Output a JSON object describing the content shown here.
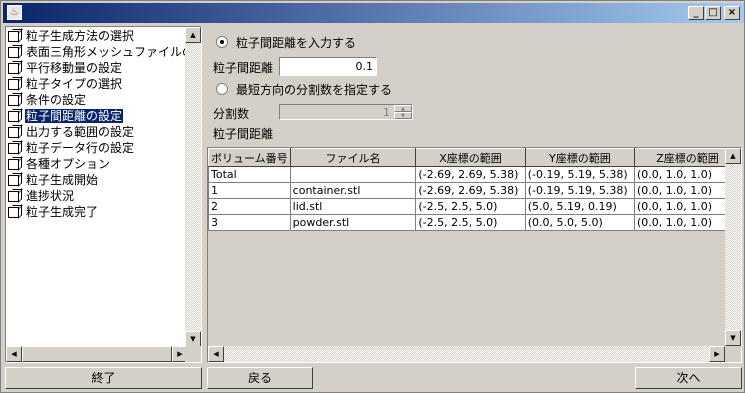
{
  "window": {
    "icon": "java-cup-icon",
    "controls": {
      "minimize": "_",
      "maximize": "□",
      "close": "×"
    }
  },
  "tree": {
    "items": [
      {
        "label": "粒子生成方法の選択",
        "selected": false
      },
      {
        "label": "表面三角形メッシュファイルの選択",
        "selected": false
      },
      {
        "label": "平行移動量の設定",
        "selected": false
      },
      {
        "label": "粒子タイプの選択",
        "selected": false
      },
      {
        "label": "条件の設定",
        "selected": false
      },
      {
        "label": "粒子間距離の設定",
        "selected": true
      },
      {
        "label": "出力する範囲の設定",
        "selected": false
      },
      {
        "label": "粒子データ行の設定",
        "selected": false
      },
      {
        "label": "各種オプション",
        "selected": false
      },
      {
        "label": "粒子生成開始",
        "selected": false
      },
      {
        "label": "進捗状況",
        "selected": false
      },
      {
        "label": "粒子生成完了",
        "selected": false
      }
    ]
  },
  "form": {
    "radio_input_distance": "粒子間距離を入力する",
    "distance_label": "粒子間距離",
    "distance_value": "0.1",
    "radio_divisions": "最短方向の分割数を指定する",
    "divisions_label": "分割数",
    "divisions_value": "1",
    "table_caption": "粒子間距離"
  },
  "table": {
    "headers": [
      "ボリューム番号",
      "ファイル名",
      "X座標の範囲",
      "Y座標の範囲",
      "Z座標の範囲"
    ],
    "rows": [
      [
        "Total",
        "",
        "(-2.69, 2.69, 5.38)",
        "(-0.19, 5.19, 5.38)",
        "(0.0, 1.0, 1.0)"
      ],
      [
        "1",
        "container.stl",
        "(-2.69, 2.69, 5.38)",
        "(-0.19, 5.19, 5.38)",
        "(0.0, 1.0, 1.0)"
      ],
      [
        "2",
        "lid.stl",
        "(-2.5, 2.5, 5.0)",
        "(5.0, 5.19, 0.19)",
        "(0.0, 1.0, 1.0)"
      ],
      [
        "3",
        "powder.stl",
        "(-2.5, 2.5, 5.0)",
        "(0.0, 5.0, 5.0)",
        "(0.0, 1.0, 1.0)"
      ]
    ]
  },
  "buttons": {
    "finish": "終了",
    "back": "戻る",
    "next": "次へ"
  }
}
